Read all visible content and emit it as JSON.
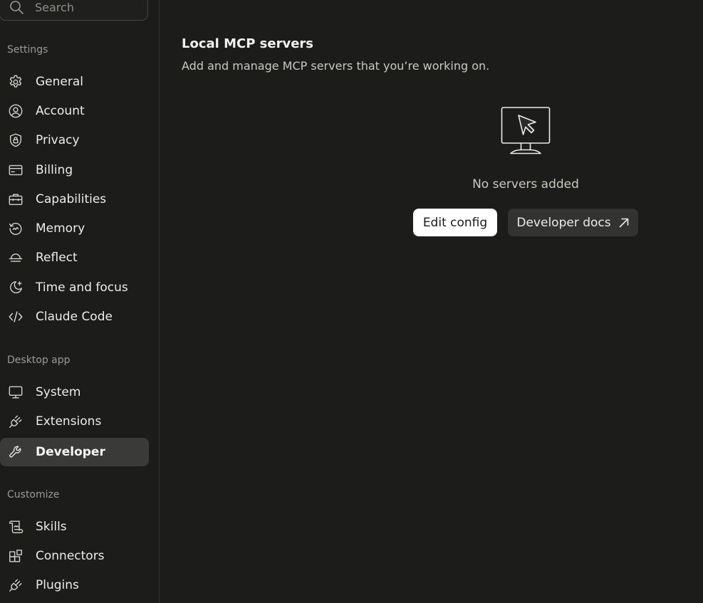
{
  "sidebar": {
    "search": {
      "placeholder": "Search",
      "icon": "search-icon"
    },
    "sections": [
      {
        "label": "Settings",
        "items": [
          {
            "label": "General",
            "icon": "gear-icon"
          },
          {
            "label": "Account",
            "icon": "user-circle-icon"
          },
          {
            "label": "Privacy",
            "icon": "shield-lock-icon"
          },
          {
            "label": "Billing",
            "icon": "credit-card-icon"
          },
          {
            "label": "Capabilities",
            "icon": "toolbox-icon"
          },
          {
            "label": "Memory",
            "icon": "history-icon"
          },
          {
            "label": "Reflect",
            "icon": "sunrise-icon"
          },
          {
            "label": "Time and focus",
            "icon": "moon-star-icon"
          },
          {
            "label": "Claude Code",
            "icon": "code-icon"
          }
        ]
      },
      {
        "label": "Desktop app",
        "items": [
          {
            "label": "System",
            "icon": "monitor-icon"
          },
          {
            "label": "Extensions",
            "icon": "plug-icon"
          },
          {
            "label": "Developer",
            "icon": "wrench-icon",
            "active": true
          }
        ]
      },
      {
        "label": "Customize",
        "items": [
          {
            "label": "Skills",
            "icon": "scroll-icon"
          },
          {
            "label": "Connectors",
            "icon": "blocks-icon"
          },
          {
            "label": "Plugins",
            "icon": "plug-icon"
          }
        ]
      }
    ]
  },
  "main": {
    "title": "Local MCP servers",
    "subtitle": "Add and manage MCP servers that you’re working on.",
    "empty_state": {
      "icon": "monitor-cursor-icon",
      "text": "No servers added"
    },
    "buttons": {
      "edit_config": "Edit config",
      "developer_docs": "Developer docs",
      "developer_docs_icon": "external-arrow-icon"
    }
  },
  "colors": {
    "background": "#1c1c1b",
    "active_item": "#3a3a38",
    "primary_button": "#ffffff",
    "secondary_button": "#333331"
  }
}
